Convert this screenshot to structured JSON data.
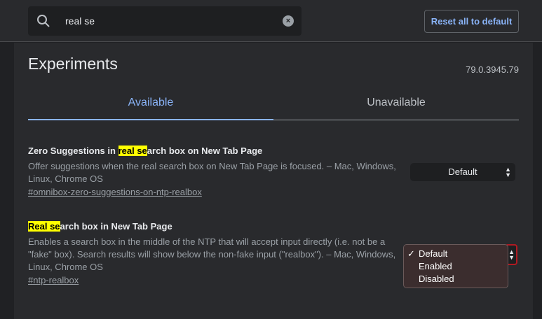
{
  "search": {
    "value": "real se"
  },
  "toolbar": {
    "reset_label": "Reset all to default"
  },
  "page": {
    "title": "Experiments",
    "version": "79.0.3945.79"
  },
  "tabs": [
    {
      "label": "Available"
    },
    {
      "label": "Unavailable"
    }
  ],
  "experiments": [
    {
      "title_hl": "real se",
      "title_pre": "Zero Suggestions in ",
      "title_post": "arch box on New Tab Page",
      "description": "Offer suggestions when the real search box on New Tab Page is focused. – Mac, Windows, Linux, Chrome OS",
      "link": "#omnibox-zero-suggestions-on-ntp-realbox",
      "selected": "Default"
    },
    {
      "title_hl": "Real se",
      "title_pre": "",
      "title_post": "arch box in New Tab Page",
      "description": "Enables a search box in the middle of the NTP that will accept input directly (i.e. not be a \"fake\" box). Search results will show below the non-fake input (\"realbox\"). – Mac, Windows, Linux, Chrome OS",
      "link": "#ntp-realbox",
      "selected": "Default",
      "options": [
        "Default",
        "Enabled",
        "Disabled"
      ]
    }
  ]
}
